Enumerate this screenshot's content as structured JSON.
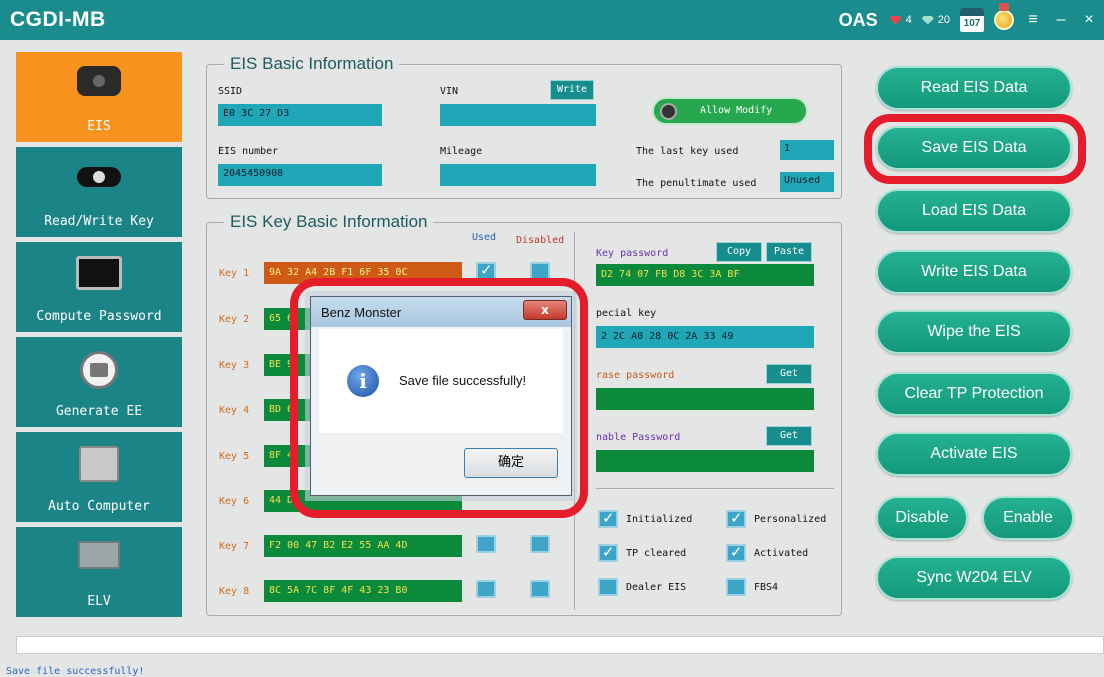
{
  "titlebar": {
    "title": "CGDI-MB",
    "oas": "OAS",
    "red_count": "4",
    "green_count": "20",
    "calendar": "107"
  },
  "nav": [
    {
      "label": "EIS",
      "icon": "eis-module-icon",
      "active": true
    },
    {
      "label": "Read/Write Key",
      "icon": "car-key-icon"
    },
    {
      "label": "Compute Password",
      "icon": "computer-screen-icon"
    },
    {
      "label": "Generate EE",
      "icon": "printer-icon"
    },
    {
      "label": "Auto Computer",
      "icon": "ecu-icon"
    },
    {
      "label": "ELV",
      "icon": "circuit-board-icon"
    }
  ],
  "eis_basic": {
    "title": "EIS Basic Information",
    "ssid_label": "SSID",
    "ssid_value": "E0 3C 27 D3",
    "vin_label": "VIN",
    "vin_value": "",
    "write_btn": "Write",
    "allow_modify": "Allow Modify",
    "eis_number_label": "EIS number",
    "eis_number_value": "2045450908",
    "mileage_label": "Mileage",
    "mileage_value": "",
    "last_key_label": "The last key used",
    "last_key_value": "1",
    "penultimate_label": "The penultimate used",
    "penultimate_value": "Unused"
  },
  "eis_key": {
    "title": "EIS Key Basic Information",
    "used_header": "Used",
    "disabled_header": "Disabled",
    "keys": [
      {
        "label": "Key 1",
        "value": "9A 32 A4 2B F1 6F 35 0C"
      },
      {
        "label": "Key 2",
        "value": "65 6"
      },
      {
        "label": "Key 3",
        "value": "BE 9"
      },
      {
        "label": "Key 4",
        "value": "BD 6"
      },
      {
        "label": "Key 5",
        "value": "8F 4"
      },
      {
        "label": "Key 6",
        "value": "44 D"
      },
      {
        "label": "Key 7",
        "value": "F2 00 47 B2 E2 55 AA 4D"
      },
      {
        "label": "Key 8",
        "value": "8C 5A 7C 8F 4F 43 23 B0"
      }
    ],
    "key_password_label": "Key password",
    "copy_btn": "Copy",
    "paste_btn": "Paste",
    "key_password_value": "D2 74 07 FB D8 3C 3A BF",
    "special_key_label": "pecial key",
    "special_key_value": "2 2C A0 28 0C 2A 33 49",
    "erase_password_label": "rase password",
    "erase_get_btn": "Get",
    "erase_password_value": "",
    "enable_password_label": "nable Password",
    "enable_get_btn": "Get",
    "enable_password_value": "",
    "status_checks": [
      {
        "label": "Initialized",
        "checked": true
      },
      {
        "label": "Personalized",
        "checked": true
      },
      {
        "label": "TP cleared",
        "checked": true
      },
      {
        "label": "Activated",
        "checked": true
      },
      {
        "label": "Dealer EIS",
        "checked": false
      },
      {
        "label": "FBS4",
        "checked": false
      }
    ]
  },
  "actions": {
    "read": "Read  EIS Data",
    "save": "Save EIS Data",
    "load": "Load EIS Data",
    "write": "Write EIS Data",
    "wipe": "Wipe the EIS",
    "clear_tp": "Clear TP Protection",
    "activate": "Activate EIS",
    "disable": "Disable",
    "enable": "Enable",
    "sync": "Sync W204 ELV"
  },
  "dialog": {
    "title": "Benz Monster",
    "close": "x",
    "message": "Save file successfully!",
    "ok": "确定"
  },
  "status": {
    "text": "Save  file  successfully!"
  },
  "colors": {
    "accent": "#1a8c8e",
    "active_nav": "#f7931e",
    "highlight": "#e51d2a"
  }
}
